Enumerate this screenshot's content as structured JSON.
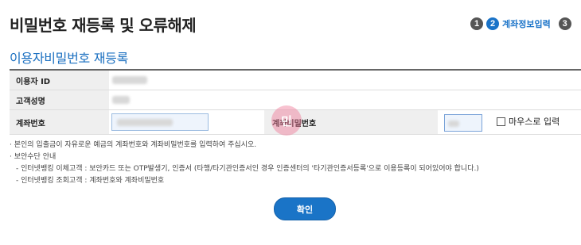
{
  "page_title": "비밀번호 재등록 및 오류해제",
  "steps": [
    {
      "num": "1",
      "label": ""
    },
    {
      "num": "2",
      "label": "계좌정보입력"
    },
    {
      "num": "3",
      "label": ""
    }
  ],
  "section_title": "이용자비밀번호 재등록",
  "form": {
    "user_id_label": "이용자 ID",
    "customer_name_label": "고객성명",
    "account_number_label": "계좌번호",
    "account_password_label": "계좌비밀번호",
    "mouse_input_label": "마우스로 입력",
    "stamp_text": "민"
  },
  "notes": [
    "· 본인의 입출금이 자유로운 예금의 계좌번호와 계좌비밀번호를 입력하여 주십시오.",
    "· 보안수단 안내",
    "- 인터넷뱅킹 이체고객 : 보안카드 또는 OTP발생기, 인증서 (타행/타기관인증서인 경우 인증센터의 '타기관인증서등록'으로 이용등록이 되어있어야 합니다.)",
    "- 인터넷뱅킹 조회고객 : 계좌번호와 계좌비밀번호"
  ],
  "confirm_label": "확인",
  "colors": {
    "accent": "#1a74c7",
    "step_done": "#555555"
  }
}
